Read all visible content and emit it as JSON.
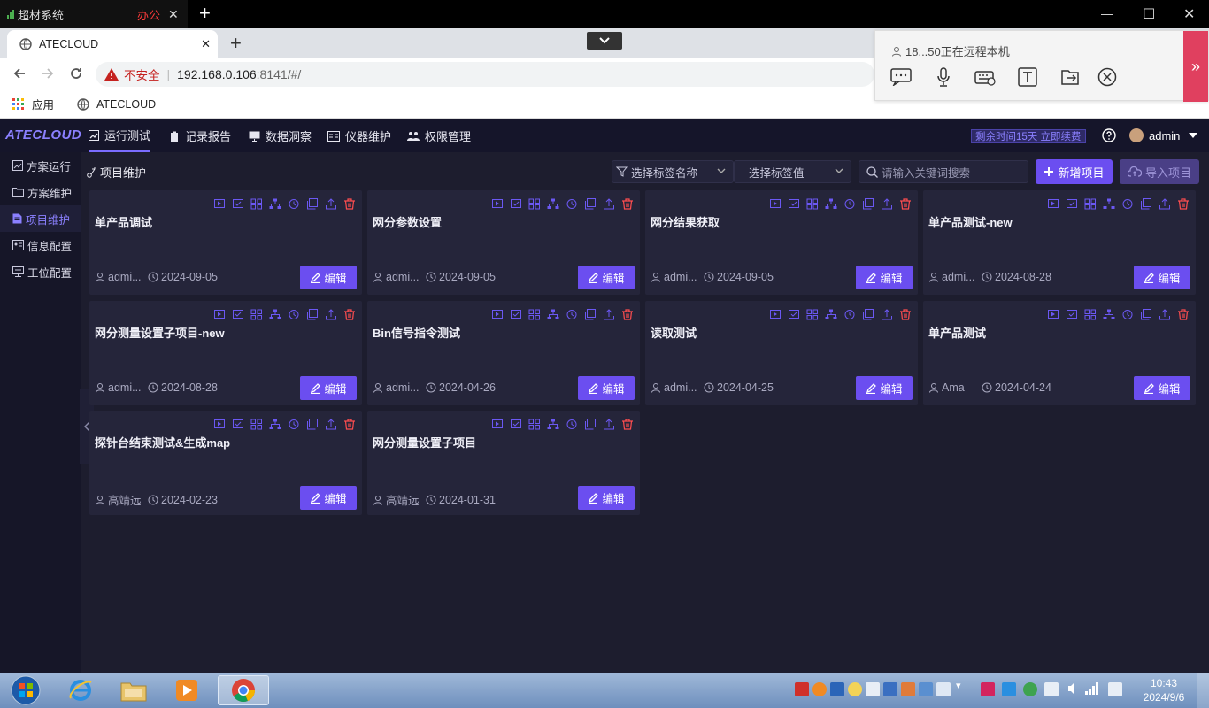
{
  "os_tab": {
    "title": "超材系统",
    "tag": "办公"
  },
  "browser": {
    "tab_title": "ATECLOUD",
    "security": "不安全",
    "url_host": "192.168.0.106",
    "url_rest": ":8141/#/",
    "bookmarks": [
      "应用",
      "ATECLOUD"
    ]
  },
  "remote": {
    "status": "18...50正在远程本机"
  },
  "app": {
    "logo": "ATECLOUD",
    "nav": [
      "运行测试",
      "记录报告",
      "数据洞察",
      "仪器维护",
      "权限管理"
    ],
    "remain": "剩余时间15天 立即续费",
    "user": "admin",
    "sidebar": [
      "方案运行",
      "方案维护",
      "项目维护",
      "信息配置",
      "工位配置"
    ],
    "breadcrumb": "项目维护",
    "filter_tag_name": "选择标签名称",
    "filter_tag_value": "选择标签值",
    "search_placeholder": "请输入关键词搜索",
    "btn_new": "新增项目",
    "btn_import": "导入项目",
    "edit_label": "编辑",
    "cards": [
      {
        "title": "单产品调试",
        "user": "admi...",
        "date": "2024-09-05"
      },
      {
        "title": "网分参数设置",
        "user": "admi...",
        "date": "2024-09-05"
      },
      {
        "title": "网分结果获取",
        "user": "admi...",
        "date": "2024-09-05"
      },
      {
        "title": "单产品测试-new",
        "user": "admi...",
        "date": "2024-08-28"
      },
      {
        "title": "网分测量设置子项目-new",
        "user": "admi...",
        "date": "2024-08-28"
      },
      {
        "title": "Bin信号指令测试",
        "user": "admi...",
        "date": "2024-04-26"
      },
      {
        "title": "读取测试",
        "user": "admi...",
        "date": "2024-04-25"
      },
      {
        "title": "单产品测试",
        "user": "Ama",
        "date": "2024-04-24"
      },
      {
        "title": "探针台结束测试&生成map",
        "user": "高靖远",
        "date": "2024-02-23"
      },
      {
        "title": "网分测量设置子项目",
        "user": "高靖远",
        "date": "2024-01-31"
      }
    ]
  },
  "taskbar": {
    "time": "10:43",
    "date": "2024/9/6"
  },
  "colors": {
    "accent": "#6b4ef0",
    "delete": "#ff4d4f",
    "bg": "#1d1d2e",
    "card": "#25253a"
  }
}
